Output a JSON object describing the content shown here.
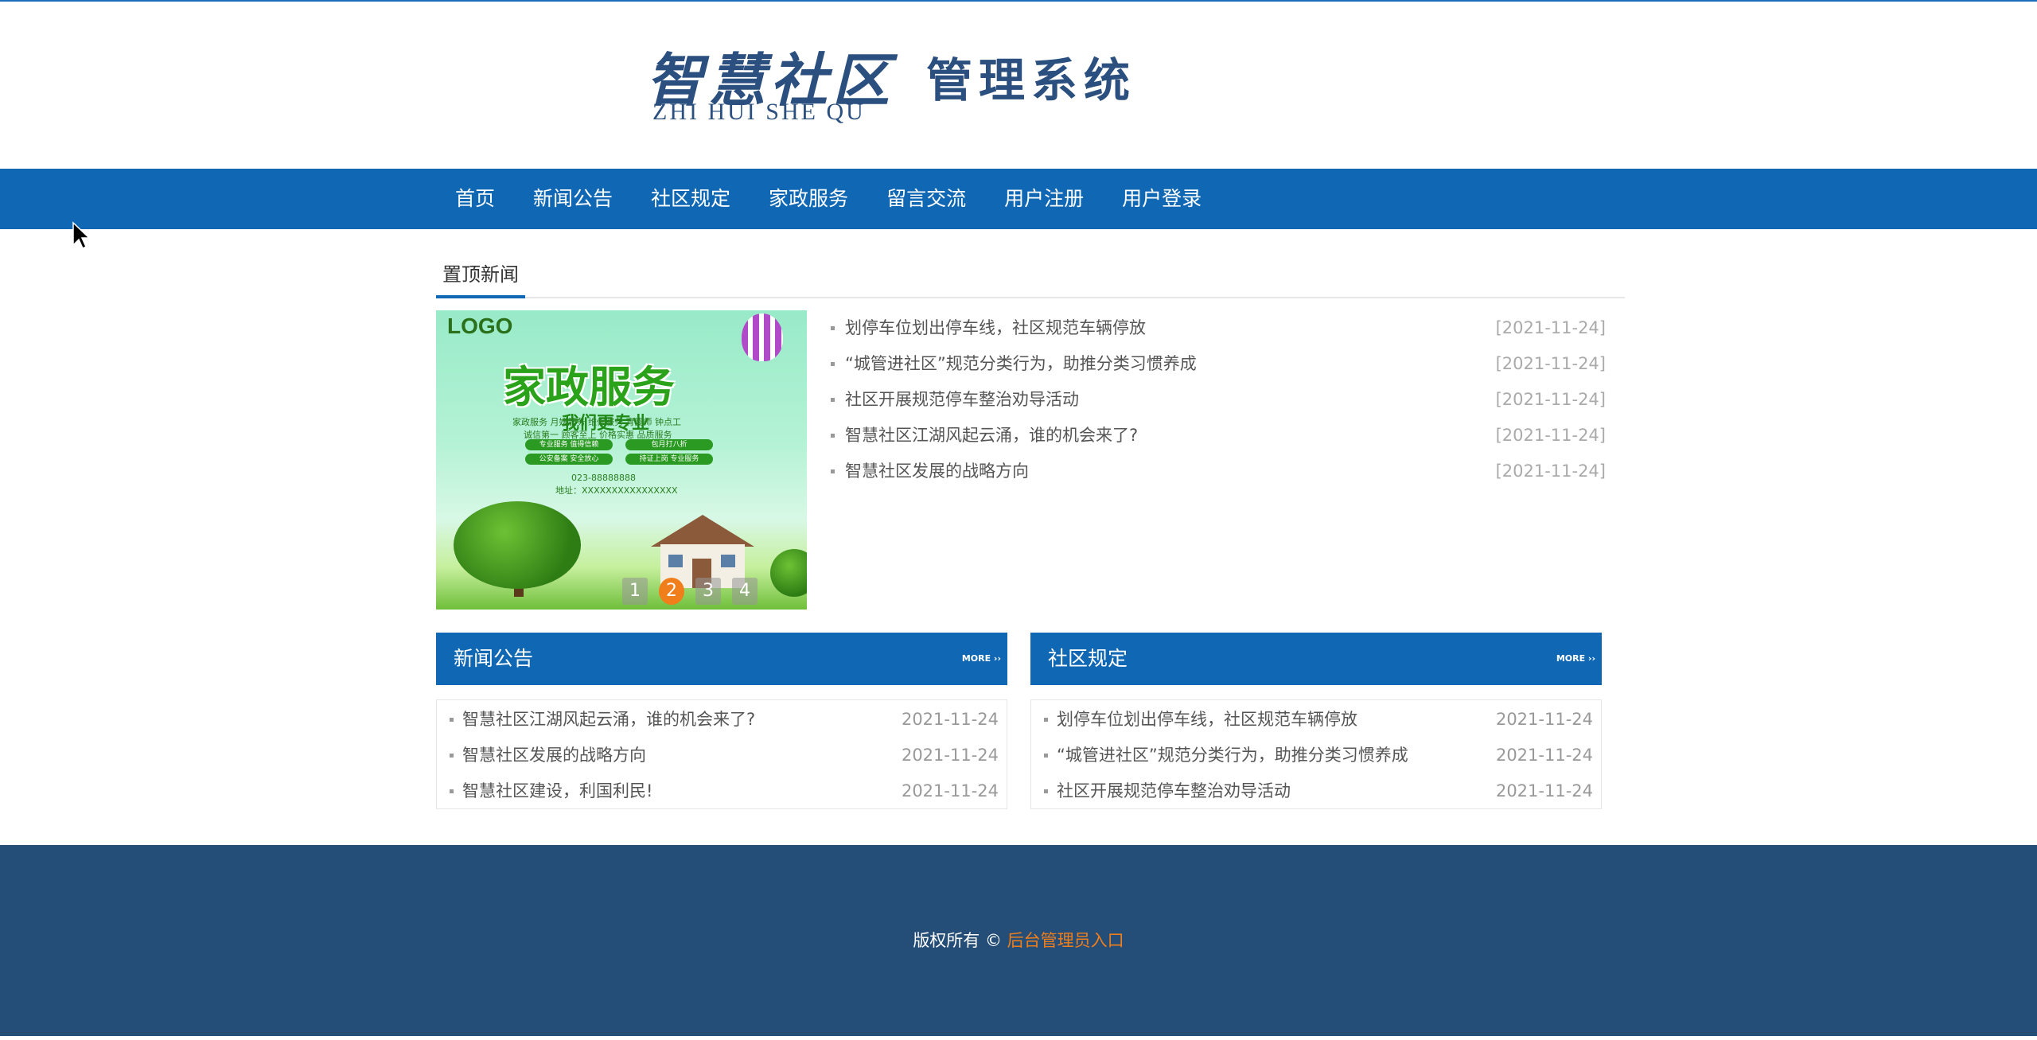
{
  "logo": {
    "title_cn": "智慧社区",
    "pinyin": "ZHI  HUI  SHE  QU",
    "subtitle": "管理系统"
  },
  "nav": {
    "items": [
      "首页",
      "新闻公告",
      "社区规定",
      "家政服务",
      "留言交流",
      "用户注册",
      "用户登录"
    ]
  },
  "top_news": {
    "title": "置顶新闻",
    "slider": {
      "logo_text": "LOGO",
      "headline": "家政服务",
      "subheadline": "我们更专业",
      "line1": "家政服务 月嫂服务 维修服务 育婴师 钟点工",
      "line2": "诚信第一 顾客至上 价格实惠 品质服务",
      "pills": [
        "专业服务 值得信赖",
        "包月打八折",
        "公安备案 安全放心",
        "持证上岗 专业服务"
      ],
      "phone": "023-88888888",
      "address": "地址：XXXXXXXXXXXXXXXX",
      "dots": [
        "1",
        "2",
        "3",
        "4"
      ],
      "active_dot": 2
    },
    "items": [
      {
        "title": "划停车位划出停车线，社区规范车辆停放",
        "date": "[2021-11-24]"
      },
      {
        "title": "“城管进社区”规范分类行为，助推分类习惯养成",
        "date": "[2021-11-24]"
      },
      {
        "title": "社区开展规范停车整治劝导活动",
        "date": "[2021-11-24]"
      },
      {
        "title": "智慧社区江湖风起云涌，谁的机会来了?",
        "date": "[2021-11-24]"
      },
      {
        "title": "智慧社区发展的战略方向",
        "date": "[2021-11-24]"
      }
    ]
  },
  "news_box": {
    "title": "新闻公告",
    "more": "MORE ››",
    "items": [
      {
        "title": "智慧社区江湖风起云涌，谁的机会来了?",
        "date": "2021-11-24"
      },
      {
        "title": "智慧社区发展的战略方向",
        "date": "2021-11-24"
      },
      {
        "title": "智慧社区建设，利国利民!",
        "date": "2021-11-24"
      }
    ]
  },
  "rules_box": {
    "title": "社区规定",
    "more": "MORE ››",
    "items": [
      {
        "title": "划停车位划出停车线，社区规范车辆停放",
        "date": "2021-11-24"
      },
      {
        "title": "“城管进社区”规范分类行为，助推分类习惯养成",
        "date": "2021-11-24"
      },
      {
        "title": "社区开展规范停车整治劝导活动",
        "date": "2021-11-24"
      }
    ]
  },
  "footer": {
    "copyright": "版权所有 © ",
    "admin_link": "后台管理员入口"
  },
  "colors": {
    "nav_bg": "#1068b5",
    "footer_bg": "#244d78",
    "accent": "#f07e1b",
    "logo_text": "#2b4f7e"
  }
}
